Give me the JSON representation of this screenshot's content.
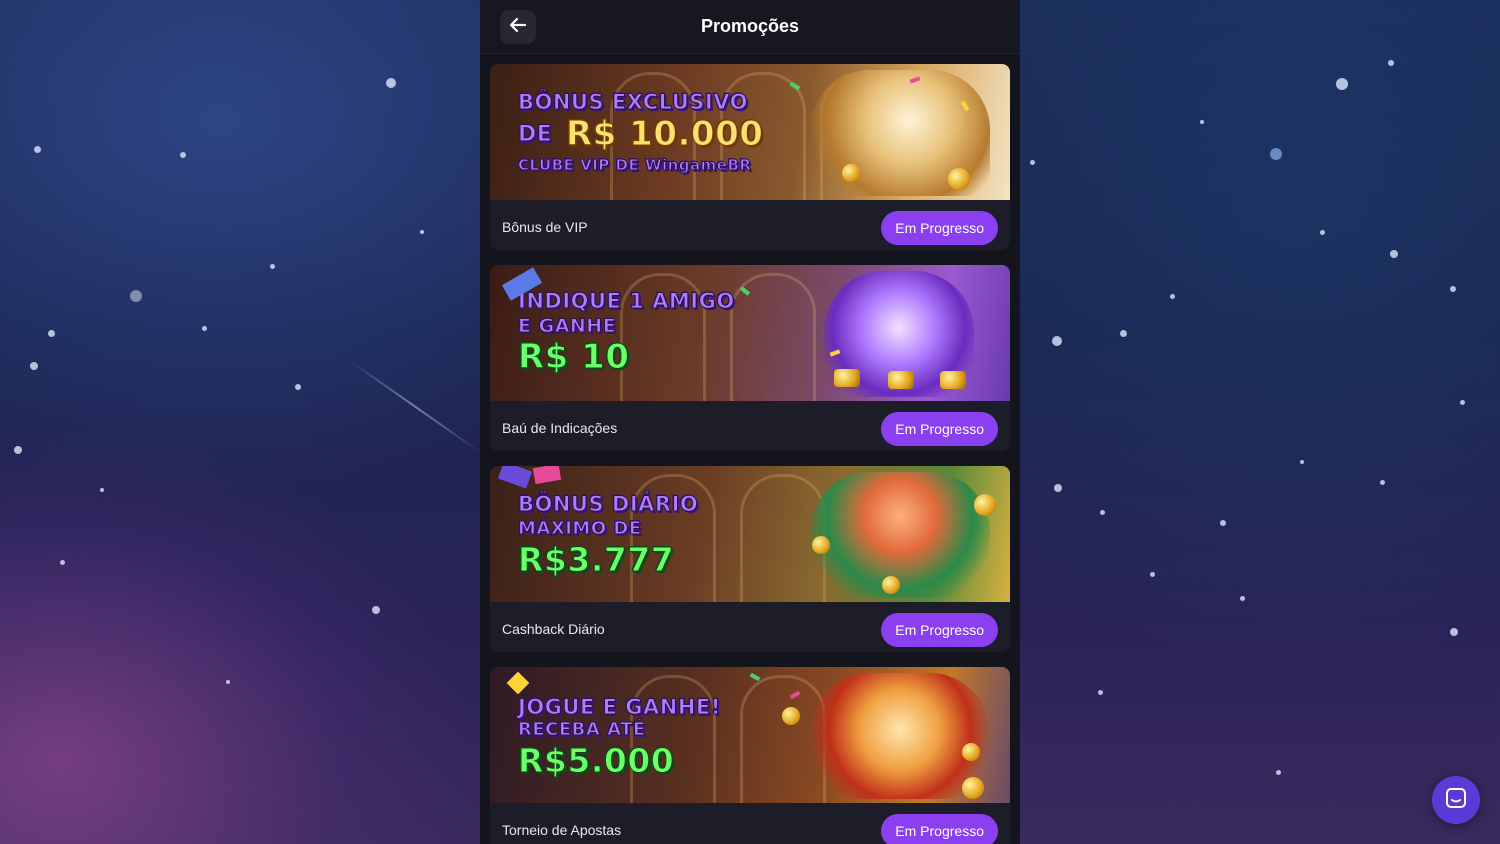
{
  "header": {
    "title": "Promoções"
  },
  "promotions": [
    {
      "name": "Bônus de VIP",
      "status": "Em Progresso",
      "banner": {
        "line1": "BÔNUS EXCLUSIVO",
        "line2a": "DE",
        "line2b": "R$ 10.000",
        "line3": "CLUBE VIP DE WingameBR"
      }
    },
    {
      "name": "Baú de Indicações",
      "status": "Em Progresso",
      "banner": {
        "line1": "INDIQUE 1 AMIGO",
        "line2": "E GANHE",
        "line3": "R$ 10"
      }
    },
    {
      "name": "Cashback Diário",
      "status": "Em Progresso",
      "banner": {
        "line1": "BÔNUS DIÁRIO",
        "line2": "MÁXIMO DE",
        "line3": "R$3.777"
      }
    },
    {
      "name": "Torneio de Apostas",
      "status": "Em Progresso",
      "banner": {
        "line1": "JOGUE E GANHE!",
        "line2": "RECEBA ATÉ",
        "line3": "R$5.000"
      }
    }
  ],
  "icons": {
    "back": "arrow-left-icon",
    "chat": "chat-icon"
  },
  "colors": {
    "accent": "#8a3ff0",
    "app_bg": "#13141c",
    "card_bg": "#1c1d28"
  }
}
